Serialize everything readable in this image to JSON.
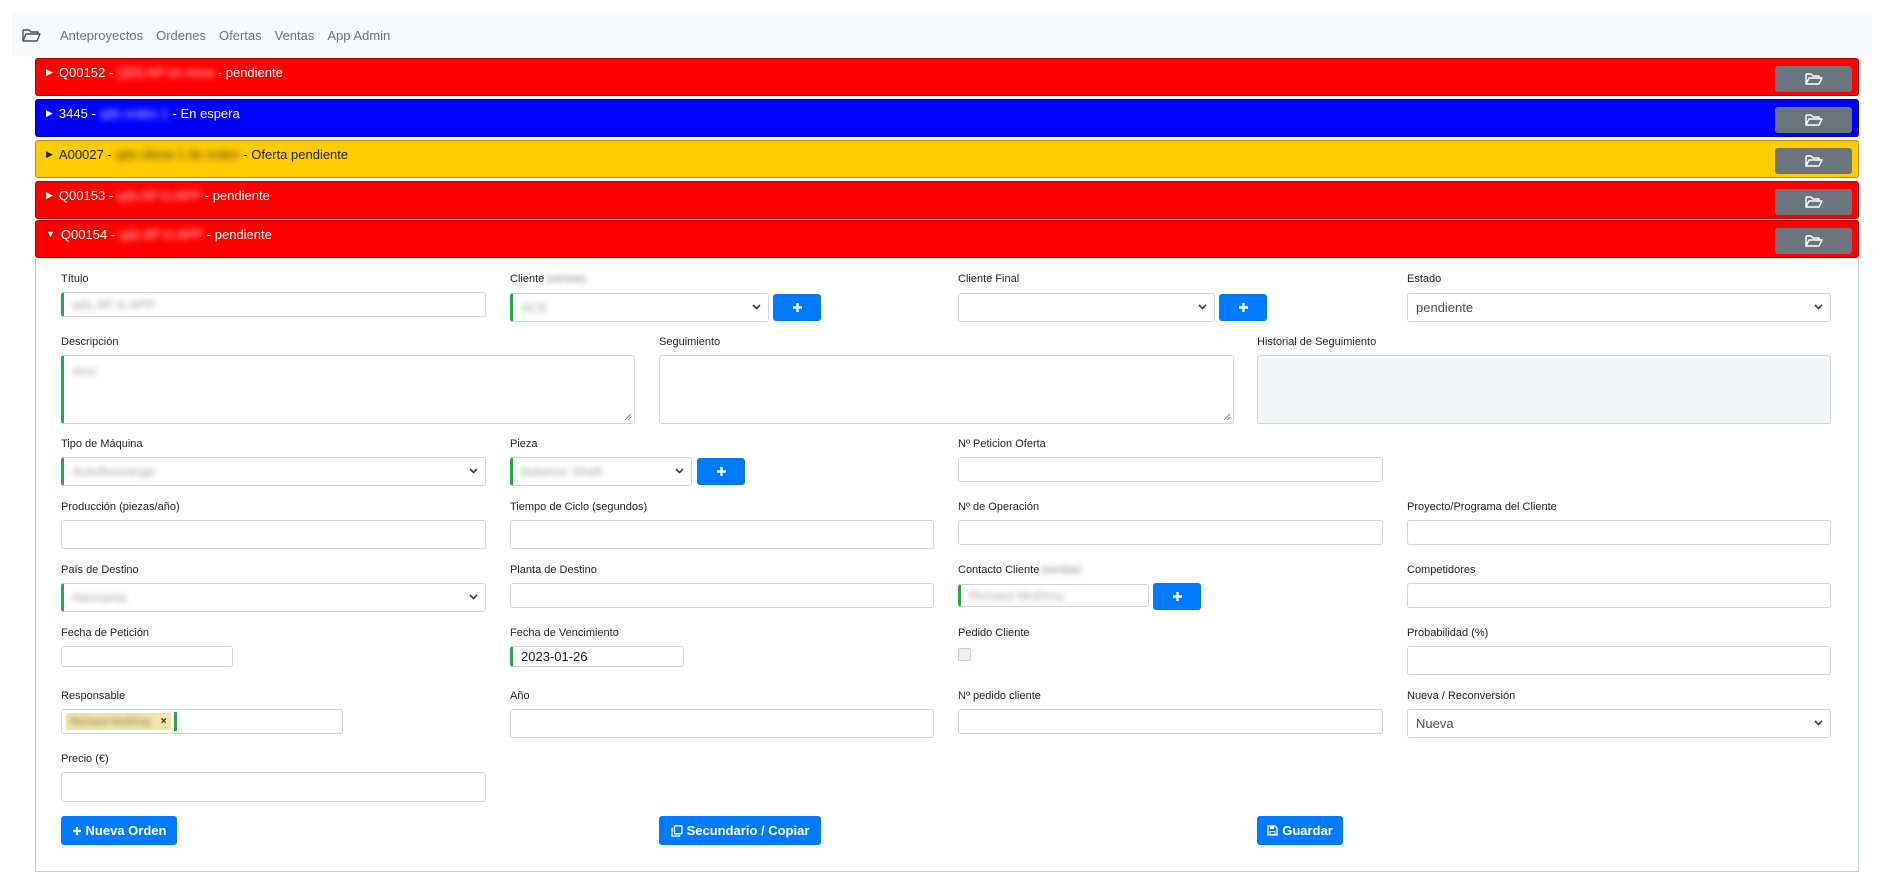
{
  "nav": {
    "brand_icon": "folder-open-icon",
    "links": [
      "Anteproyectos",
      "Ordenes",
      "Ofertas",
      "Ventas",
      "App Admin"
    ]
  },
  "rows": [
    {
      "code": "Q00152",
      "sep": "-",
      "name": "QD5 AP no nova",
      "sep2": "-",
      "status": "pendiente",
      "color": "#ff0000",
      "expanded": false
    },
    {
      "code": "3445",
      "sep": "-",
      "name": "qds orden 1",
      "sep2": "-",
      "status": "En espera",
      "color": "#0000ff",
      "expanded": false
    },
    {
      "code": "A00027",
      "sep": "-",
      "name": "qds oferta 1 de orden",
      "sep2": "-",
      "status": "Oferta pendiente",
      "color": "#ffcc00",
      "expanded": false
    },
    {
      "code": "Q00153",
      "sep": "-",
      "name": "qds AP in APP",
      "sep2": "-",
      "status": "pendiente",
      "color": "#ff0000",
      "expanded": false
    },
    {
      "code": "Q00154",
      "sep": "-",
      "name": "qds AP in APP",
      "sep2": "-",
      "status": "pendiente",
      "color": "#ff0000",
      "expanded": true
    }
  ],
  "form": {
    "titulo": {
      "label": "Título",
      "value": "qds AP in APP"
    },
    "cliente": {
      "label": "Cliente",
      "label_extra": "(ventas)",
      "value": "ACE"
    },
    "cliente_final": {
      "label": "Cliente Final",
      "value": ""
    },
    "estado": {
      "label": "Estado",
      "value": "pendiente"
    },
    "descripcion": {
      "label": "Descripción",
      "value": "desc"
    },
    "seguimiento": {
      "label": "Seguimiento",
      "value": ""
    },
    "historial": {
      "label": "Historial de Seguimiento",
      "value": ""
    },
    "tipo_maquina": {
      "label": "Tipo de Máquina",
      "value": "Autoflowrange"
    },
    "pieza": {
      "label": "Pieza",
      "value": "Balance Shaft"
    },
    "peticion_oferta": {
      "label": "Nº Peticion Oferta",
      "value": ""
    },
    "produccion": {
      "label": "Producción (piezas/año)",
      "value": ""
    },
    "tiempo_ciclo": {
      "label": "Tiempo de Ciclo (segundos)",
      "value": ""
    },
    "operacion": {
      "label": "Nº de Operación",
      "value": ""
    },
    "proyecto_cliente": {
      "label": "Proyecto/Programa del Cliente",
      "value": ""
    },
    "pais_destino": {
      "label": "País de Destino",
      "value": "Alemania"
    },
    "planta_destino": {
      "label": "Planta de Destino",
      "value": ""
    },
    "contacto_cliente": {
      "label": "Contacto Cliente",
      "label_extra": "(ventas)",
      "value": "Richard McElroy"
    },
    "competidores": {
      "label": "Competidores",
      "value": ""
    },
    "fecha_peticion": {
      "label": "Fecha de Petición",
      "value": ""
    },
    "fecha_vencimiento": {
      "label": "Fecha de Vencimiento",
      "value": "2023-01-26"
    },
    "pedido_cliente": {
      "label": "Pedido Cliente",
      "checked": false
    },
    "probabilidad": {
      "label": "Probabilidad (%)",
      "value": ""
    },
    "responsable": {
      "label": "Responsable",
      "tag": "Richard McElroy",
      "tag_remove": "×"
    },
    "anio": {
      "label": "Año",
      "value": ""
    },
    "pedido_cliente_num": {
      "label": "Nº pedido cliente",
      "value": ""
    },
    "nueva_reconversion": {
      "label": "Nueva / Reconversión",
      "value": "Nueva"
    },
    "precio": {
      "label": "Precio (€)",
      "value": ""
    }
  },
  "actions": {
    "nueva_orden": "Nueva Orden",
    "secundario": "Secundario / Copiar",
    "guardar": "Guardar"
  },
  "icons": {
    "open_row": "folder-open-icon",
    "add": "plus-icon",
    "chevron": "chevron-down-icon",
    "copy": "copy-icon",
    "save": "save-icon"
  }
}
